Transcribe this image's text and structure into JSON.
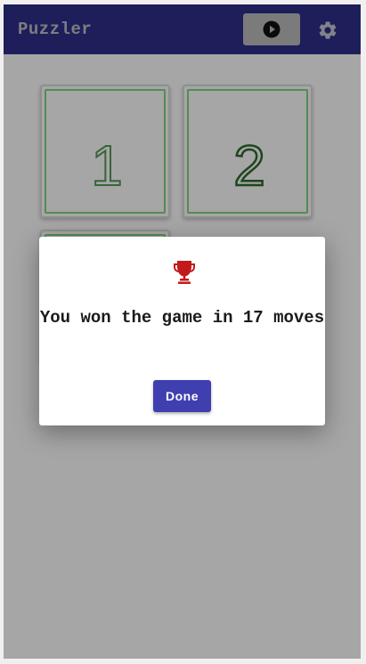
{
  "appbar": {
    "title": "Puzzler",
    "play_icon": "play-circle-icon",
    "settings_icon": "gear-icon"
  },
  "board": {
    "tiles": [
      {
        "label": "1"
      },
      {
        "label": "2"
      },
      {
        "label": ""
      }
    ]
  },
  "dialog": {
    "icon": "trophy-icon",
    "message": "You won the game in 17 moves",
    "done_label": "Done"
  },
  "colors": {
    "appbar": "#2f2f8c",
    "accent_button": "#3f3fb0",
    "trophy": "#c21a1a",
    "tile_border": "#7dd87d"
  }
}
